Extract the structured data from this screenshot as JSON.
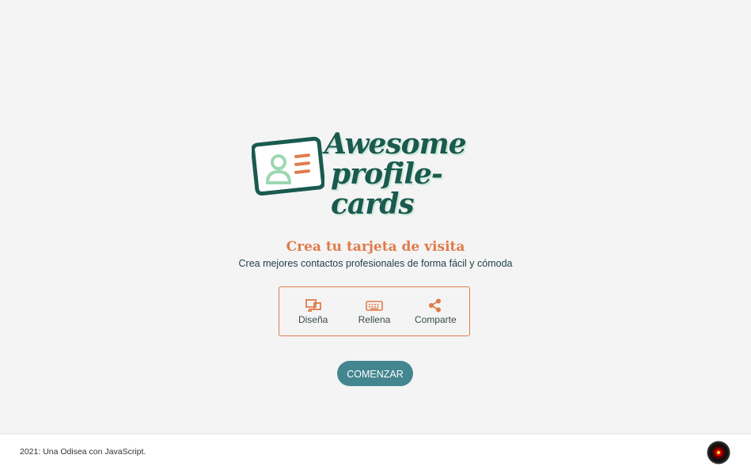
{
  "logo": {
    "line1": "Awesome",
    "line2": "profile-cards",
    "icon": "id-card-icon"
  },
  "hero": {
    "title": "Crea tu tarjeta de visita",
    "subtitle": "Crea mejores contactos profesionales de forma fácil y cómoda"
  },
  "steps": [
    {
      "label": "Diseña",
      "icon": "design-icon"
    },
    {
      "label": "Rellena",
      "icon": "keyboard-icon"
    },
    {
      "label": "Comparte",
      "icon": "share-icon"
    }
  ],
  "cta": {
    "label": "COMENZAR"
  },
  "footer": {
    "text": "2021: Una Odisea con JavaScript.",
    "icon": "hal-eye-icon"
  },
  "colors": {
    "background": "#f4f4f4",
    "accent": "#e07b4a",
    "brand_green": "#1a5a4f",
    "button": "#438690"
  }
}
